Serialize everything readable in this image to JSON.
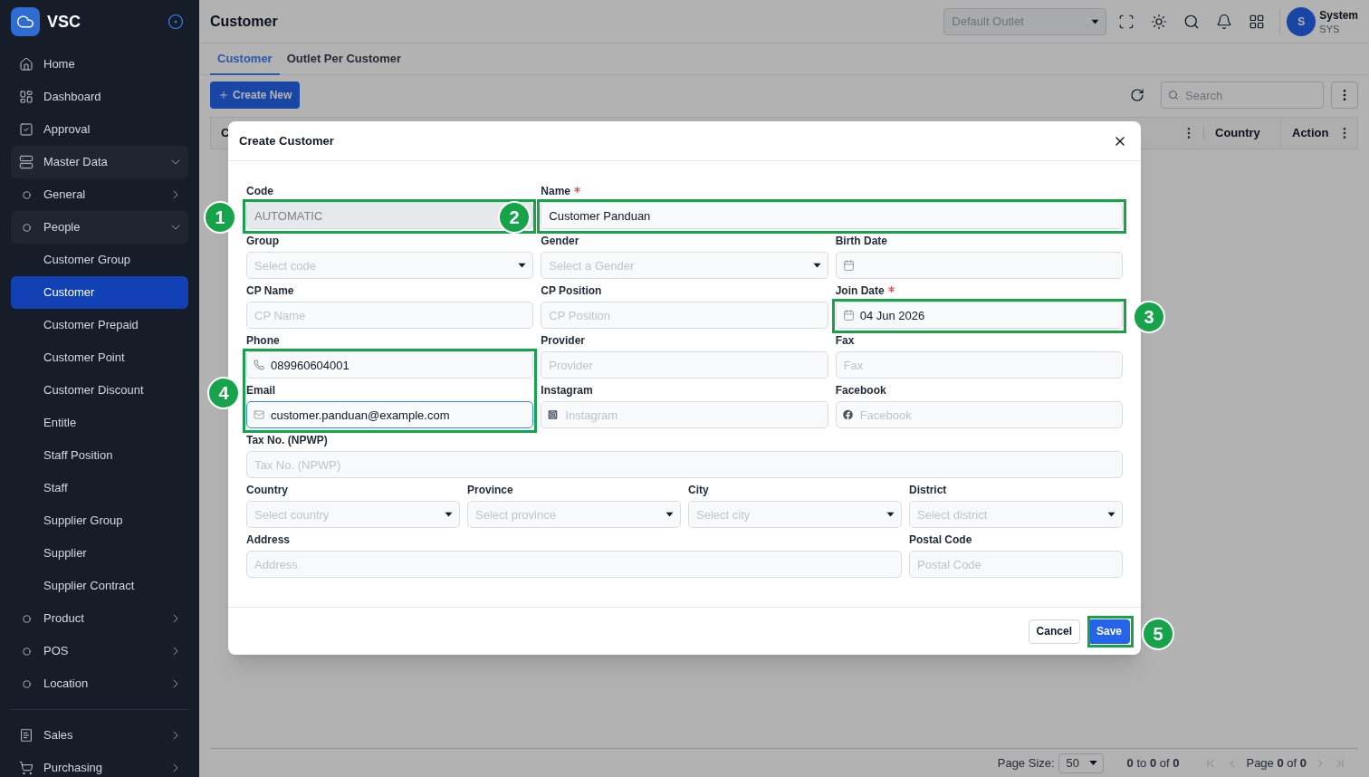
{
  "sidebar": {
    "brand": "VSC",
    "sections": [
      {
        "items": [
          {
            "label": "Home",
            "selected": false
          },
          {
            "label": "Dashboard",
            "selected": false
          },
          {
            "label": "Approval",
            "selected": false
          },
          {
            "label": "Master Data",
            "selected": false,
            "expanded": true,
            "children": [
              {
                "label": "General",
                "selected": false,
                "expanded": false
              },
              {
                "label": "People",
                "selected": false,
                "expanded": true,
                "children": [
                  {
                    "label": "Customer Group",
                    "selected": false
                  },
                  {
                    "label": "Customer",
                    "selected": true
                  },
                  {
                    "label": "Customer Prepaid",
                    "selected": false
                  },
                  {
                    "label": "Customer Point",
                    "selected": false
                  },
                  {
                    "label": "Customer Discount",
                    "selected": false
                  },
                  {
                    "label": "Entitle",
                    "selected": false
                  },
                  {
                    "label": "Staff Position",
                    "selected": false
                  },
                  {
                    "label": "Staff",
                    "selected": false
                  },
                  {
                    "label": "Supplier Group",
                    "selected": false
                  },
                  {
                    "label": "Supplier",
                    "selected": false
                  },
                  {
                    "label": "Supplier Contract",
                    "selected": false
                  }
                ]
              },
              {
                "label": "Product",
                "selected": false,
                "expanded": false
              },
              {
                "label": "POS",
                "selected": false,
                "expanded": false
              },
              {
                "label": "Location",
                "selected": false,
                "expanded": false
              }
            ]
          }
        ]
      },
      {
        "items": [
          {
            "label": "Sales",
            "selected": false,
            "expanded": false
          },
          {
            "label": "Purchasing",
            "selected": false,
            "expanded": false
          }
        ]
      }
    ]
  },
  "header": {
    "title": "Customer",
    "outlet_select": {
      "placeholder": "Default Outlet"
    },
    "user": {
      "initial": "S",
      "name": "System",
      "code": "SYS"
    }
  },
  "tabs": [
    {
      "label": "Customer",
      "selected": true
    },
    {
      "label": "Outlet Per Customer",
      "selected": false
    }
  ],
  "toolbar": {
    "create_label": "Create New",
    "search": {
      "placeholder": "Search"
    }
  },
  "table": {
    "columns": [
      {
        "label": "C"
      },
      {
        "label": "Country"
      },
      {
        "label": "Action"
      }
    ]
  },
  "pagination": {
    "page_size_label": "Page Size:",
    "page_size": "50",
    "row_summary": "**0** to **0** of **0**",
    "page_summary": "Page **0** of **0**"
  },
  "modal": {
    "title": "Create Customer",
    "rows": [
      {
        "fields": [
          {
            "label": "Code",
            "kind": "text",
            "value": "AUTOMATIC",
            "required": false,
            "disabled": true,
            "focused": false
          },
          {
            "label": "Name",
            "kind": "text",
            "value": "Customer Panduan",
            "required": true,
            "disabled": false,
            "focused": false
          }
        ]
      },
      {
        "fields": [
          {
            "label": "Group",
            "kind": "select",
            "placeholder": "Select code",
            "required": false,
            "disabled": false,
            "focused": false
          },
          {
            "label": "Gender",
            "kind": "select",
            "placeholder": "Select a Gender",
            "required": false,
            "disabled": false,
            "focused": false
          },
          {
            "label": "Birth Date",
            "kind": "date",
            "required": false,
            "disabled": false,
            "focused": false
          }
        ]
      },
      {
        "fields": [
          {
            "label": "CP Name",
            "kind": "text",
            "placeholder": "CP Name",
            "required": false,
            "disabled": false,
            "focused": false
          },
          {
            "label": "CP Position",
            "kind": "text",
            "placeholder": "CP Position",
            "required": false,
            "disabled": false,
            "focused": false
          },
          {
            "label": "Join Date",
            "kind": "date",
            "value": "04 Jun 2026",
            "required": true,
            "disabled": false,
            "focused": false
          }
        ]
      },
      {
        "fields": [
          {
            "label": "Phone",
            "kind": "phone",
            "value": "089960604001",
            "required": false,
            "disabled": false,
            "focused": false
          },
          {
            "label": "Provider",
            "kind": "text",
            "placeholder": "Provider",
            "required": false,
            "disabled": false,
            "focused": false
          },
          {
            "label": "Fax",
            "kind": "text",
            "placeholder": "Fax",
            "required": false,
            "disabled": false,
            "focused": false
          }
        ]
      },
      {
        "fields": [
          {
            "label": "Email",
            "kind": "email",
            "value": "customer.panduan@example.com",
            "required": false,
            "disabled": false,
            "focused": true
          },
          {
            "label": "Instagram",
            "kind": "instagram",
            "placeholder": "Instagram",
            "required": false,
            "disabled": false,
            "focused": false
          },
          {
            "label": "Facebook",
            "kind": "facebook",
            "placeholder": "Facebook",
            "required": false,
            "disabled": false,
            "focused": false
          }
        ]
      },
      {
        "fields": [
          {
            "label": "Tax No. (NPWP)",
            "kind": "text",
            "placeholder": "Tax No. (NPWP)",
            "required": false,
            "disabled": false,
            "focused": false
          }
        ]
      },
      {
        "fields": [
          {
            "label": "Country",
            "kind": "select",
            "placeholder": "Select country",
            "required": false,
            "disabled": false,
            "focused": false
          },
          {
            "label": "Province",
            "kind": "select",
            "placeholder": "Select province",
            "required": false,
            "disabled": false,
            "focused": false
          },
          {
            "label": "City",
            "kind": "select",
            "placeholder": "Select city",
            "required": false,
            "disabled": false,
            "focused": false
          },
          {
            "label": "District",
            "kind": "select",
            "placeholder": "Select district",
            "required": false,
            "disabled": false,
            "focused": false
          }
        ]
      },
      {
        "fields": [
          {
            "label": "Address",
            "kind": "text",
            "placeholder": "Address",
            "required": false,
            "disabled": false,
            "focused": false
          },
          {
            "label": "Postal Code",
            "kind": "text",
            "placeholder": "Postal Code",
            "required": false,
            "disabled": false,
            "focused": false
          }
        ]
      }
    ],
    "buttons": [
      {
        "label": "Cancel",
        "kind": "secondary"
      },
      {
        "label": "Save",
        "kind": "primary"
      }
    ]
  },
  "annotations": [
    {
      "number": "1"
    },
    {
      "number": "2"
    },
    {
      "number": "3"
    },
    {
      "number": "4"
    },
    {
      "number": "5"
    }
  ]
}
